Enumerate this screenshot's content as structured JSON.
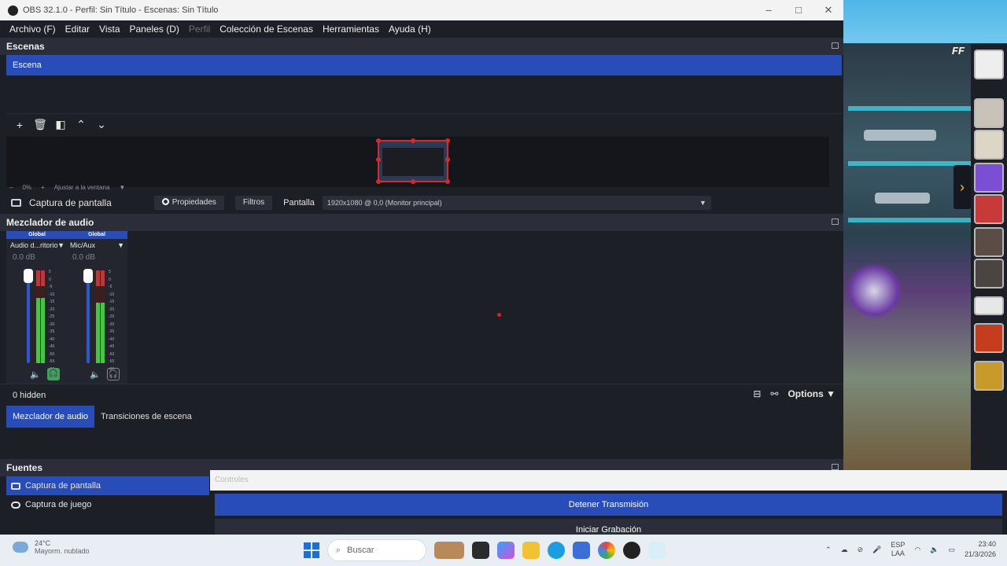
{
  "window": {
    "title": "OBS 32.1.0 - Perfil: Sin Título - Escenas: Sin Título"
  },
  "menu": [
    "Archivo (F)",
    "Editar",
    "Vista",
    "Paneles (D)",
    "Perfil",
    "Colección de Escenas",
    "Herramientas",
    "Ayuda (H)"
  ],
  "scenes": {
    "header": "Escenas",
    "items": [
      "Escena"
    ]
  },
  "preview": {
    "zoom": "0%",
    "fit": "Ajustar a la ventana"
  },
  "source_toolbar": {
    "name": "Captura de pantalla",
    "properties": "Propiedades",
    "filters": "Filtros",
    "display_label": "Pantalla",
    "display_value": "1920x1080 @ 0,0 (Monitor principal)"
  },
  "mixer": {
    "header": "Mezclador de audio",
    "channels": [
      {
        "tag": "Global",
        "name": "Audio d...ritorio",
        "db": "0.0 dB",
        "level": 0.7
      },
      {
        "tag": "Global",
        "name": "Mic/Aux",
        "db": "0.0 dB",
        "level": 0.65
      }
    ],
    "scale": [
      "5",
      "0",
      "-5",
      "-10",
      "-15",
      "-20",
      "-25",
      "-30",
      "-35",
      "-40",
      "-45",
      "-50",
      "-55",
      "-60"
    ],
    "hidden": "0 hidden",
    "options": "Options"
  },
  "tabs": [
    "Mezclador de audio",
    "Transiciones de escena"
  ],
  "sources": {
    "header": "Fuentes",
    "items": [
      "Captura de pantalla",
      "Captura de juego"
    ]
  },
  "controls": {
    "header": "Controles",
    "buttons": [
      "Detener Transmisión",
      "Iniciar Grabación"
    ]
  },
  "taskbar": {
    "weather_temp": "24°C",
    "weather_desc": "Mayorm. nublado",
    "search": "Buscar",
    "lang1": "ESP",
    "lang2": "LAA",
    "time": "23:40",
    "date": "21/3/2026"
  },
  "game": {
    "logo": "FF"
  },
  "colors": {
    "accent": "#284cb8",
    "panel": "#1d1f26",
    "header": "#2b2e38",
    "meter_green": "#4ac24a",
    "selection_red": "#d32b2b"
  }
}
